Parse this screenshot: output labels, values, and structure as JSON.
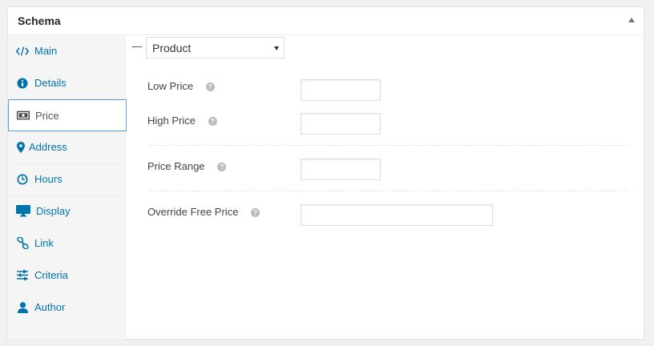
{
  "metabox": {
    "title": "Schema"
  },
  "sidebar": {
    "items": [
      {
        "label": "Main",
        "icon": "code-icon"
      },
      {
        "label": "Details",
        "icon": "info-icon"
      },
      {
        "label": "Price",
        "icon": "money-icon"
      },
      {
        "label": "Address",
        "icon": "map-marker-icon"
      },
      {
        "label": "Hours",
        "icon": "clock-icon"
      },
      {
        "label": "Display",
        "icon": "desktop-icon"
      },
      {
        "label": "Link",
        "icon": "link-icon"
      },
      {
        "label": "Criteria",
        "icon": "sliders-icon"
      },
      {
        "label": "Author",
        "icon": "user-icon"
      }
    ],
    "active": "Price"
  },
  "price": {
    "schema_type": "Product",
    "fields": {
      "low_price": {
        "label": "Low Price",
        "value": ""
      },
      "high_price": {
        "label": "High Price",
        "value": ""
      },
      "price_range": {
        "label": "Price Range",
        "value": ""
      },
      "override_free_price": {
        "label": "Override Free Price",
        "value": ""
      }
    },
    "help_glyph": "?"
  },
  "colors": {
    "link": "#0073aa",
    "active_border": "#5b9dd9",
    "help": "#bbbbbb"
  }
}
